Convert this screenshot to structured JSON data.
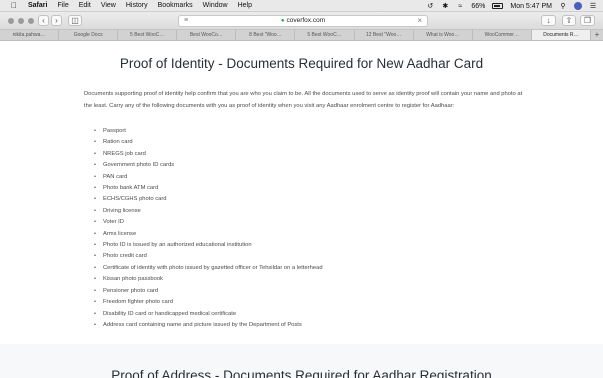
{
  "menubar": {
    "app": "Safari",
    "items": [
      "File",
      "Edit",
      "View",
      "History",
      "Bookmarks",
      "Window",
      "Help"
    ],
    "battery": "66%",
    "clock": "Mon 5:47 PM"
  },
  "toolbar": {
    "url": "coverfox.com"
  },
  "tabs": [
    "nikita.pahwa…",
    "Google Docs",
    "5 Best WooC…",
    "Best WooCo…",
    "8 Best \"Woo…",
    "5 Best WooC…",
    "12 Best \"Woo…",
    "What is Woo…",
    "WooCommer…",
    "Documents R…"
  ],
  "page": {
    "title": "Proof of Identity - Documents Required for New Aadhar Card",
    "intro": "Documents supporting proof of identity help confirm that you are who you claim to be. All the documents used to serve as identity proof will contain your name and photo at the least. Carry any of the following documents with you as proof of identity when you visit any Aadhaar enrolment centre to register for Aadhaar:",
    "documents": [
      "Passport",
      "Ration card",
      "NREGS job card",
      "Government photo ID cards",
      "PAN card",
      "Photo bank ATM card",
      "ECHS/CGHS photo card",
      "Driving license",
      "Voter ID",
      "Arms license",
      "Photo ID is issued by an authorized educational institution",
      "Photo credit card",
      "Certificate of identity with photo issued by gazetted officer or Tehsildar on a letterhead",
      "Kissan photo passbook",
      "Pensioner photo card",
      "Freedom fighter photo card",
      "Disability ID card or handicapped medical certificate",
      "Address card containing name and picture issued by the Department of Posts"
    ],
    "next_heading": "Proof of Address - Documents Required for Aadhar Registration"
  }
}
